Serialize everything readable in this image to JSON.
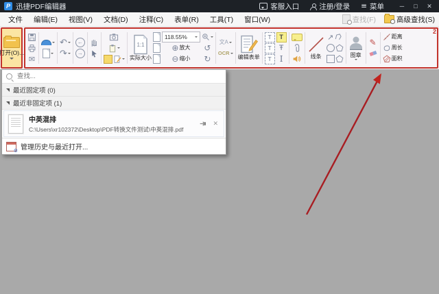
{
  "titlebar": {
    "logo_letter": "P",
    "app_title": "迅捷PDF编辑器",
    "support": "客服入口",
    "login": "注册/登录",
    "menu": "菜单",
    "controls": {
      "minimize": "─",
      "maximize": "□",
      "close": "✕"
    }
  },
  "menubar": {
    "items": [
      "文件",
      "编辑(E)",
      "视图(V)",
      "文档(D)",
      "注释(C)",
      "表单(R)",
      "工具(T)",
      "窗口(W)"
    ],
    "find": "查找(F)",
    "advanced_find": "高级查找(S)"
  },
  "toolbar": {
    "open_label": "打开(O)...",
    "zoom_value": "118.55%",
    "zoom_in": "放大",
    "zoom_out": "缩小",
    "actual_size": "实际大小",
    "edit_form": "编辑表单",
    "line": "线条",
    "stamp": "图章",
    "distance": "距离",
    "perimeter": "周长",
    "area": "面积",
    "annotation_number": "2",
    "glyphs": {
      "undo": "↶",
      "redo": "↷",
      "back": "←",
      "forward": "→",
      "mail": "✉",
      "plus": "⊕",
      "minus": "⊖",
      "rotate_left": "↺",
      "rotate_right": "↻",
      "translate": "文A",
      "ocr": "OCR",
      "one_to_one": "1:1",
      "text": "T",
      "text_strike": "Ŧ",
      "text_serif": "I",
      "pencil": "✎",
      "arrow_ne": "↗",
      "menu_bars": "≡"
    }
  },
  "recent_panel": {
    "search_placeholder": "查找...",
    "pinned_header": "最近固定项 (0)",
    "unpinned_header": "最近非固定项 (1)",
    "file_title": "中英混排",
    "file_path": "C:\\Users\\xr102372\\Desktop\\PDF转换文件测试\\中英混排.pdf",
    "manage_label": "管理历史与最近打开..."
  },
  "colors": {
    "annotation_red": "#c2322b",
    "titlebar_bg": "#1d2126",
    "workspace_bg": "#a9a9a9",
    "highlight_yellow": "#f7ef8e"
  }
}
